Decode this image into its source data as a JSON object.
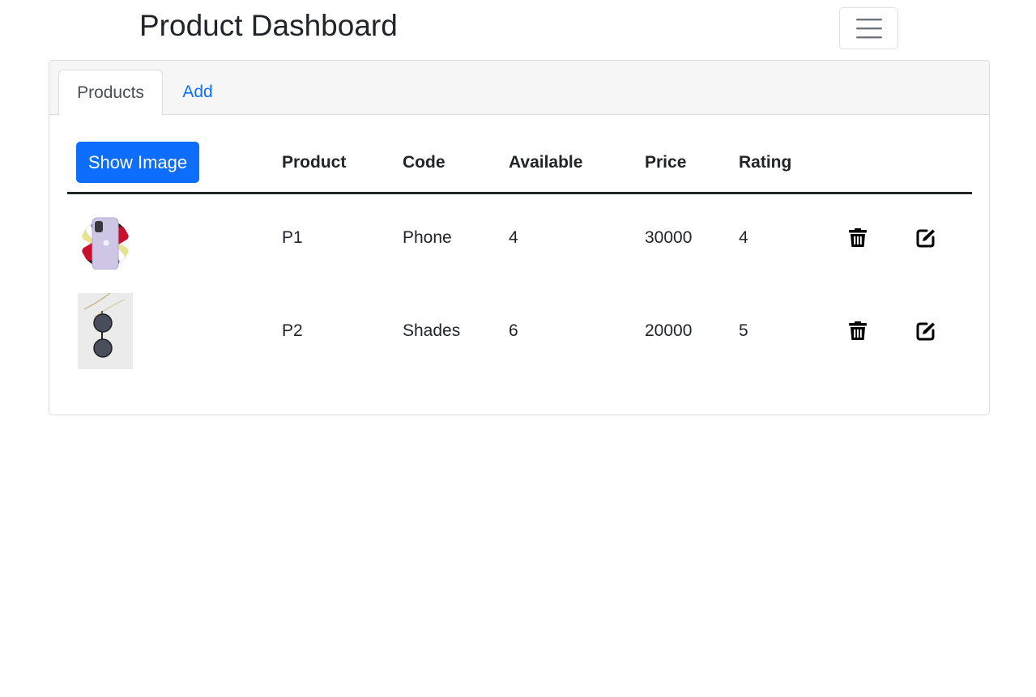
{
  "header": {
    "title": "Product Dashboard",
    "menu_icon": "hamburger-menu-icon"
  },
  "tabs": [
    {
      "label": "Products",
      "active": true
    },
    {
      "label": "Add",
      "active": false
    }
  ],
  "table": {
    "show_image_label": "Show Image",
    "columns": [
      "Product",
      "Code",
      "Available",
      "Price",
      "Rating"
    ],
    "rows": [
      {
        "product": "P1",
        "code": "Phone",
        "available": "4",
        "price": "30000",
        "rating": "4",
        "image_icon": "phone-photo",
        "delete_icon": "trash-icon",
        "edit_icon": "edit-icon"
      },
      {
        "product": "P2",
        "code": "Shades",
        "available": "6",
        "price": "20000",
        "rating": "5",
        "image_icon": "sunglasses-photo",
        "delete_icon": "trash-icon",
        "edit_icon": "edit-icon"
      }
    ]
  },
  "colors": {
    "primary": "#0d6efd",
    "text": "#212529",
    "header_bg": "#f6f6f6",
    "border": "#dcdcdc"
  }
}
